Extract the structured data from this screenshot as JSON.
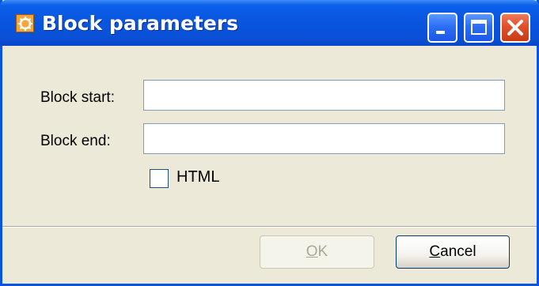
{
  "window": {
    "title": "Block parameters",
    "icon": "gear-icon",
    "controls": {
      "minimize": "minimize-icon",
      "maximize": "maximize-icon",
      "close": "close-icon"
    }
  },
  "form": {
    "block_start_label": "Block start:",
    "block_start_value": "",
    "block_end_label": "Block end:",
    "block_end_value": "",
    "html_checkbox_label": "HTML",
    "html_checked": false
  },
  "buttons": {
    "ok": {
      "accel": "O",
      "rest": "K",
      "enabled": false
    },
    "cancel": {
      "accel": "C",
      "rest": "ancel",
      "enabled": true
    }
  },
  "colors": {
    "title_bar": "#0a55df",
    "dialog_bg": "#ece9d8",
    "close_button": "#e0502a",
    "disabled_text": "#aca899"
  }
}
